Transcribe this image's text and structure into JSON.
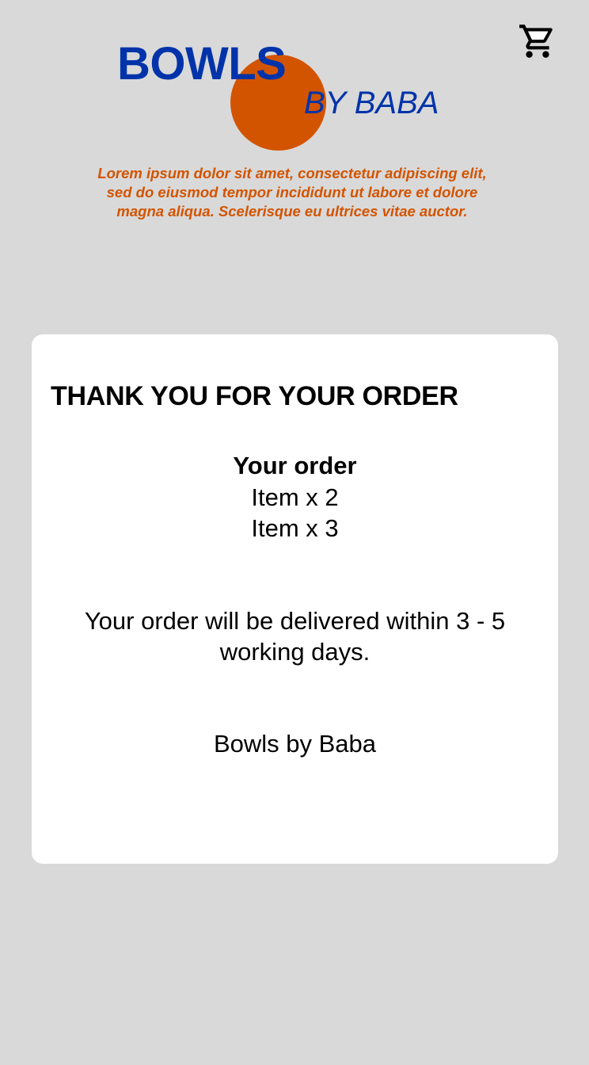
{
  "header": {
    "brand_main": "BOWLS",
    "brand_sub": "BY BABA",
    "tagline": "Lorem ipsum dolor sit amet, consectetur adipiscing elit, sed do eiusmod tempor incididunt ut labore et dolore magna aliqua. Scelerisque eu ultrices vitae auctor.",
    "cart_icon": "shopping-cart-icon"
  },
  "confirmation": {
    "title": "THANK YOU FOR YOUR ORDER",
    "order_heading": "Your order",
    "items": [
      "Item x 2",
      "Item x 3"
    ],
    "delivery_note": "Your order will be delivered within 3 - 5 working days.",
    "signoff": "Bowls by Baba"
  },
  "colors": {
    "background": "#d9d9d9",
    "brand_blue": "#0033aa",
    "brand_orange": "#d35400",
    "card": "#ffffff"
  }
}
